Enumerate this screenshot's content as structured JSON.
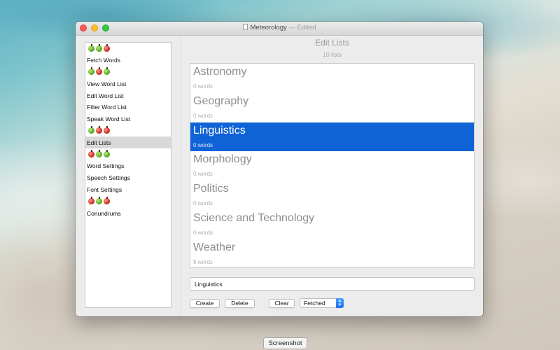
{
  "window": {
    "title": "Meteorology",
    "title_suffix": "— Edited"
  },
  "sidebar": {
    "rows": [
      {
        "type": "apples",
        "apples": [
          "green",
          "green",
          "red"
        ]
      },
      {
        "type": "item",
        "label": "Fetch Words"
      },
      {
        "type": "apples",
        "apples": [
          "green",
          "red",
          "green"
        ]
      },
      {
        "type": "item",
        "label": "View Word List"
      },
      {
        "type": "item",
        "label": "Edit Word List"
      },
      {
        "type": "item",
        "label": "Filter Word List"
      },
      {
        "type": "item",
        "label": "Speak Word List"
      },
      {
        "type": "apples",
        "apples": [
          "green",
          "red",
          "red"
        ]
      },
      {
        "type": "item",
        "label": "Edit Lists",
        "selected": true
      },
      {
        "type": "apples",
        "apples": [
          "red",
          "green",
          "green"
        ]
      },
      {
        "type": "item",
        "label": "Word Settings"
      },
      {
        "type": "item",
        "label": "Speech Settings"
      },
      {
        "type": "item",
        "label": "Font Settings"
      },
      {
        "type": "apples",
        "apples": [
          "red",
          "green",
          "red"
        ]
      },
      {
        "type": "item",
        "label": "Conundrums"
      }
    ]
  },
  "main": {
    "title": "Edit Lists",
    "subtitle": "10 lists",
    "lists": [
      {
        "name": "Astronomy",
        "count": "0 words"
      },
      {
        "name": "Geography",
        "count": "0 words"
      },
      {
        "name": "Linguistics",
        "count": "0 words",
        "selected": true
      },
      {
        "name": "Morphology",
        "count": "0 words"
      },
      {
        "name": "Politics",
        "count": "0 words"
      },
      {
        "name": "Science and Technology",
        "count": "0 words"
      },
      {
        "name": "Weather",
        "count": "8 words"
      }
    ],
    "name_field_value": "Linguistics",
    "buttons": {
      "create": "Create",
      "delete": "Delete",
      "clear": "Clear"
    },
    "popup": {
      "selected": "Fetched"
    }
  },
  "desktop": {
    "screenshot_button": "Screenshot"
  },
  "colors": {
    "selection": "#0f63d6",
    "apple_green": "#4fa21c",
    "apple_red": "#c51f17"
  }
}
